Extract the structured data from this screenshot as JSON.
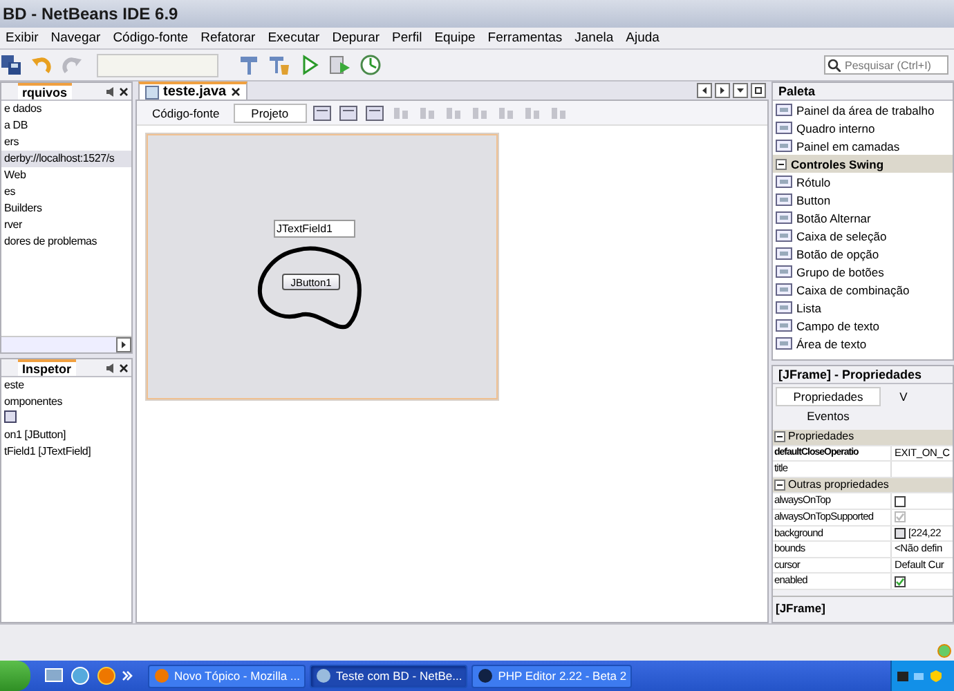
{
  "window": {
    "title": "BD - NetBeans IDE 6.9"
  },
  "menu": [
    "Exibir",
    "Navegar",
    "Código-fonte",
    "Refatorar",
    "Executar",
    "Depurar",
    "Perfil",
    "Equipe",
    "Ferramentas",
    "Janela",
    "Ajuda"
  ],
  "toolbar": {
    "search": {
      "placeholder": "Pesquisar (Ctrl+I)"
    }
  },
  "files_panel": {
    "tab": "rquivos",
    "items": [
      {
        "label": "e dados",
        "selected": false
      },
      {
        "label": "a DB",
        "selected": false
      },
      {
        "label": "ers",
        "selected": false
      },
      {
        "label": "derby://localhost:1527/s",
        "selected": true
      },
      {
        "label": "Web",
        "selected": false
      },
      {
        "label": "es",
        "selected": false
      },
      {
        "label": "Builders",
        "selected": false
      },
      {
        "label": "rver",
        "selected": false
      },
      {
        "label": "dores de problemas",
        "selected": false
      }
    ]
  },
  "inspector_panel": {
    "tab": "Inspetor",
    "items": [
      "este",
      "omponentes",
      "on1 [JButton]",
      "tField1 [JTextField]"
    ]
  },
  "editor": {
    "tab": "teste.java",
    "views": [
      {
        "label": "Código-fonte",
        "selected": false
      },
      {
        "label": "Projeto",
        "selected": true
      }
    ],
    "form": {
      "text_field": "JTextField1",
      "button": "JButton1"
    }
  },
  "palette": {
    "title": "Paleta",
    "items": [
      {
        "kind": "item",
        "label": "Painel da área de trabalho"
      },
      {
        "kind": "item",
        "label": "Quadro interno"
      },
      {
        "kind": "item",
        "label": "Painel em camadas"
      },
      {
        "kind": "category",
        "label": "Controles Swing",
        "expanded": true
      },
      {
        "kind": "item",
        "label": "Rótulo"
      },
      {
        "kind": "item",
        "label": "Button"
      },
      {
        "kind": "item",
        "label": "Botão Alternar"
      },
      {
        "kind": "item",
        "label": "Caixa de seleção"
      },
      {
        "kind": "item",
        "label": "Botão de opção"
      },
      {
        "kind": "item",
        "label": "Grupo de botões"
      },
      {
        "kind": "item",
        "label": "Caixa de combinação"
      },
      {
        "kind": "item",
        "label": "Lista"
      },
      {
        "kind": "item",
        "label": "Campo de texto"
      },
      {
        "kind": "item",
        "label": "Área de texto"
      }
    ]
  },
  "properties": {
    "title": "[JFrame] - Propriedades",
    "tabs": [
      {
        "label": "Propriedades",
        "selected": true
      },
      {
        "label": "V",
        "selected": false
      },
      {
        "label": "Eventos",
        "selected": false
      }
    ],
    "rows": [
      {
        "kind": "section",
        "label": "Propriedades",
        "expanded": true
      },
      {
        "kind": "text",
        "name": "defaultCloseOperatio",
        "value": "EXIT_ON_C",
        "modified": true
      },
      {
        "kind": "text",
        "name": "title",
        "modified": false
      },
      {
        "kind": "section",
        "label": "Outras propriedades",
        "expanded": true
      },
      {
        "kind": "check",
        "name": "alwaysOnTop",
        "checked": false,
        "disabled": false
      },
      {
        "kind": "check",
        "name": "alwaysOnTopSupported",
        "checked": true,
        "disabled": true
      },
      {
        "kind": "color",
        "name": "background",
        "value": "[224,22",
        "modified": false
      },
      {
        "kind": "text",
        "name": "bounds",
        "value": "<Não defin",
        "modified": false
      },
      {
        "kind": "text",
        "name": "cursor",
        "value": "Default Cur",
        "modified": false
      },
      {
        "kind": "check",
        "name": "enabled",
        "checked": true,
        "disabled": false
      }
    ],
    "description": "[JFrame]"
  },
  "taskbar": {
    "tasks": [
      {
        "label": "Novo Tópico - Mozilla ...",
        "selected": false
      },
      {
        "label": "Teste com BD - NetBe...",
        "selected": true
      },
      {
        "label": "PHP Editor 2.22 - Beta 2",
        "selected": false
      }
    ]
  }
}
